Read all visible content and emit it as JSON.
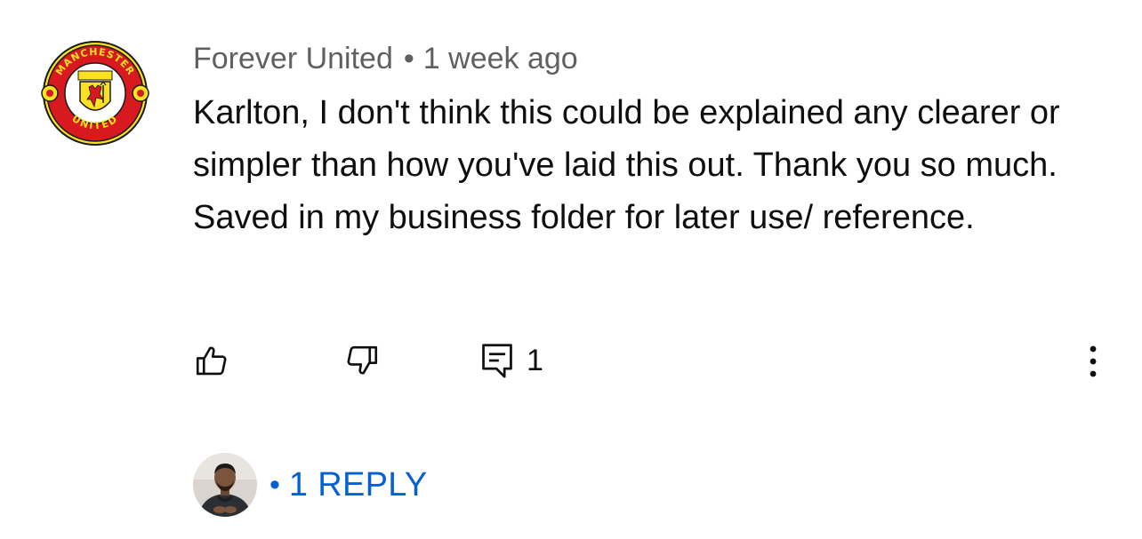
{
  "comment": {
    "author": "Forever United",
    "separator": "•",
    "timestamp": "1 week ago",
    "text": "Karlton, I don't think this could be explained any clearer or simpler than how you've laid this out. Thank you so much. Saved in my business folder for later use/ reference.",
    "avatar_icon": "manchester-united-crest",
    "avatar_crest_top_text": "MANCHESTER",
    "avatar_crest_bottom_text": "UNITED"
  },
  "actions": {
    "like_icon": "thumbs-up-icon",
    "dislike_icon": "thumbs-down-icon",
    "reply_icon": "comment-icon",
    "reply_count": "1",
    "more_icon": "more-vertical-icon"
  },
  "replies": {
    "dot": "•",
    "label": "1 REPLY",
    "avatar_icon": "replier-avatar",
    "link_color": "#065fd4"
  },
  "colors": {
    "meta_text": "#606060",
    "body_text": "#0f0f0f",
    "crest_red": "#d81920",
    "crest_yellow": "#fbe122"
  }
}
